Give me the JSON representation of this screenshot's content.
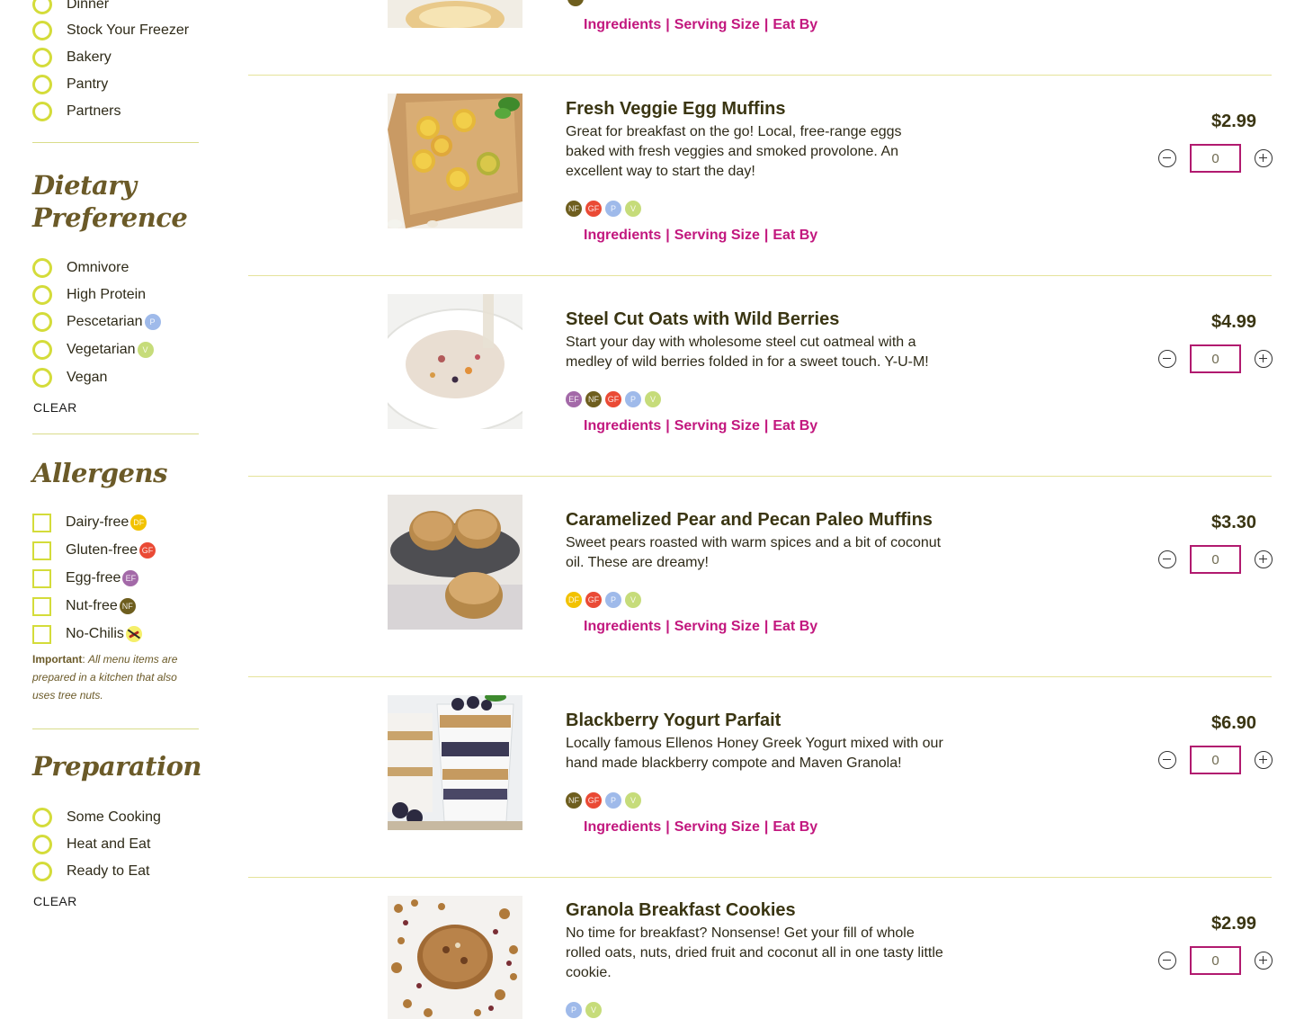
{
  "sidebar": {
    "category_items": [
      "Dinner",
      "Stock Your Freezer",
      "Bakery",
      "Pantry",
      "Partners"
    ],
    "dietary": {
      "title_line1": "Dietary",
      "title_line2": "Preference",
      "items": [
        {
          "label": "Omnivore",
          "badge": ""
        },
        {
          "label": "High Protein",
          "badge": ""
        },
        {
          "label": "Pescetarian",
          "badge": "P"
        },
        {
          "label": "Vegetarian",
          "badge": "V"
        },
        {
          "label": "Vegan",
          "badge": ""
        }
      ],
      "clear_label": "CLEAR"
    },
    "allergens": {
      "title": "Allergens",
      "items": [
        {
          "label": "Dairy-free",
          "badge": "DF"
        },
        {
          "label": "Gluten-free",
          "badge": "GF"
        },
        {
          "label": "Egg-free",
          "badge": "EF"
        },
        {
          "label": "Nut-free",
          "badge": "NF"
        },
        {
          "label": "No-Chilis",
          "badge": ""
        }
      ],
      "note_bold": "Important",
      "note_text": "All menu items are prepared in a kitchen that also uses tree nuts."
    },
    "preparation": {
      "title": "Preparation",
      "items": [
        "Some Cooking",
        "Heat and Eat",
        "Ready to Eat"
      ],
      "clear_label": "CLEAR"
    }
  },
  "links": {
    "ingredients": "Ingredients",
    "serving_size": "Serving Size",
    "eat_by": "Eat By",
    "separator": "|"
  },
  "badge_colors": {
    "NF": "#6e5e1e",
    "GF": "#ea4a35",
    "P": "#9fbaea",
    "V": "#c6dc7a",
    "DF": "#f2c200",
    "EF": "#a369a8"
  },
  "products": [
    {
      "title": "Fresh Veggie Egg Muffins",
      "description": "Great for breakfast on the go! Local, free-range eggs baked with fresh veggies and smoked provolone. An excellent way to start the day!",
      "badges": [
        "NF",
        "GF",
        "P",
        "V"
      ],
      "price": "$2.99",
      "quantity": "0"
    },
    {
      "title": "Steel Cut Oats with Wild Berries",
      "description": "Start your day with wholesome steel cut oatmeal with a medley of wild berries folded in for a sweet touch. Y-U-M!",
      "badges": [
        "EF",
        "NF",
        "GF",
        "P",
        "V"
      ],
      "price": "$4.99",
      "quantity": "0"
    },
    {
      "title": "Caramelized Pear and Pecan Paleo Muffins",
      "description": "Sweet pears roasted with warm spices and a bit of coconut oil. These are dreamy!",
      "badges": [
        "DF",
        "GF",
        "P",
        "V"
      ],
      "price": "$3.30",
      "quantity": "0"
    },
    {
      "title": "Blackberry Yogurt Parfait",
      "description": "Locally famous Ellenos Honey Greek Yogurt mixed with our hand made blackberry compote and Maven Granola!",
      "badges": [
        "NF",
        "GF",
        "P",
        "V"
      ],
      "price": "$6.90",
      "quantity": "0"
    },
    {
      "title": "Granola Breakfast Cookies",
      "description": "No time for breakfast? Nonsense! Get your fill of whole rolled oats, nuts, dried fruit and coconut all in one tasty little cookie.",
      "badges": [
        "P",
        "V"
      ],
      "price": "$2.99",
      "quantity": "0"
    }
  ]
}
